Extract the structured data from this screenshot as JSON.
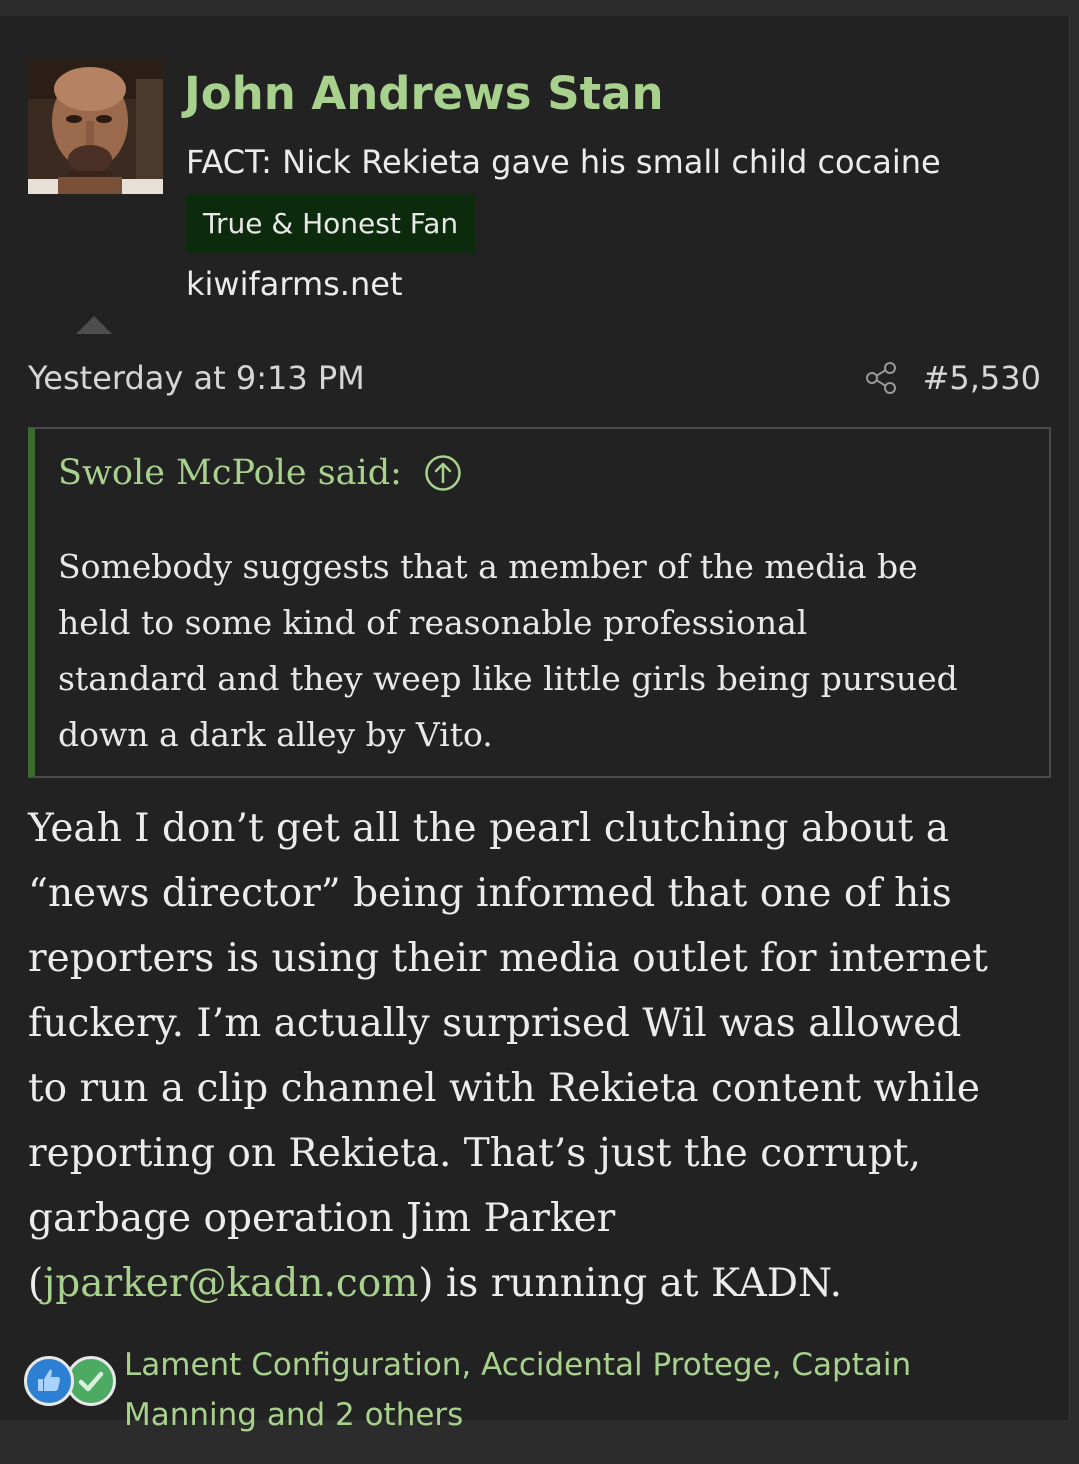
{
  "post": {
    "author": {
      "name": "John Andrews Stan",
      "title": "FACT: Nick Rekieta gave his small child cocaine",
      "banner": "True & Honest Fan",
      "site": "kiwifarms.net"
    },
    "timestamp": "Yesterday at 9:13 PM",
    "post_number": "#5,530",
    "quote": {
      "author": "Swole McPole said:",
      "lines": [
        "Somebody suggests that a member of the media be",
        "held to some kind of reasonable professional",
        "standard and they weep like little girls being pursued",
        "down a dark alley by Vito."
      ]
    },
    "message": {
      "lines": [
        "Yeah I don’t get all the pearl clutching about a",
        "“news director” being informed that one of his",
        "reporters is using their media outlet for internet",
        "fuckery. I’m actually surprised Wil was allowed",
        "to run a clip channel with Rekieta content while",
        "reporting on Rekieta. That’s just the corrupt,",
        "garbage operation Jim Parker"
      ],
      "last_line_open": "(",
      "email": "jparker@kadn.com",
      "last_line_close": ") is running at KADN."
    },
    "reactions": {
      "icons": [
        "like-icon",
        "check-icon"
      ],
      "line1": "Lament Configuration, Accidental Protege, Captain",
      "line2": "Manning and 2 others"
    }
  },
  "colors": {
    "background": "#222222",
    "accent_green": "#a8d18d",
    "banner_bg": "#0c2a0c",
    "quote_border": "#3d6a2e",
    "text": "#ececec"
  }
}
